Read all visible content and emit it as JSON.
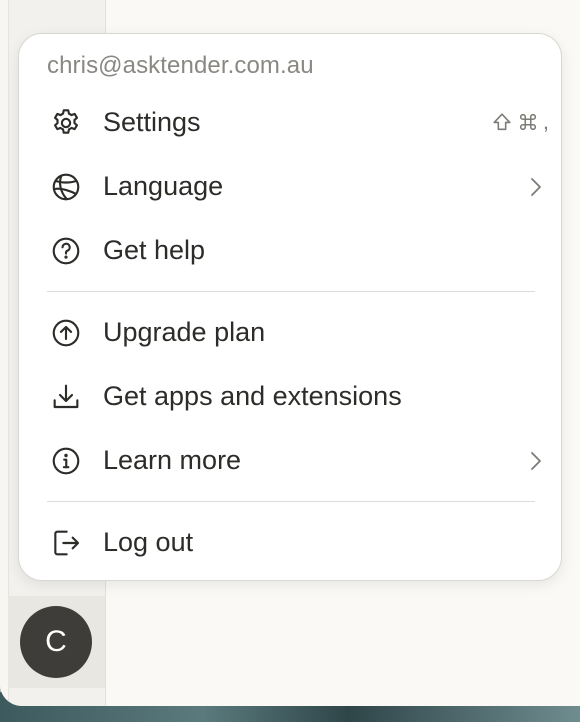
{
  "account": {
    "email": "chris@asktender.com.au",
    "avatar_initial": "C"
  },
  "menu": {
    "items": [
      {
        "label": "Settings",
        "icon": "gear-icon",
        "shortcut": [
          ",",
          "shift-icon",
          "command-icon"
        ]
      },
      {
        "label": "Language",
        "icon": "globe-icon",
        "has_submenu": true
      },
      {
        "label": "Get help",
        "icon": "help-circle-icon"
      },
      {
        "label": "Upgrade plan",
        "icon": "arrow-up-circle-icon"
      },
      {
        "label": "Get apps and extensions",
        "icon": "download-icon"
      },
      {
        "label": "Learn more",
        "icon": "info-circle-icon",
        "has_submenu": true
      },
      {
        "label": "Log out",
        "icon": "log-out-icon"
      }
    ],
    "settings_shortcut_text": ","
  },
  "colors": {
    "menu_background": "#ffffff",
    "text_primary": "#2d2c29",
    "text_muted": "#8a8882",
    "avatar_background": "#3f3d39"
  }
}
